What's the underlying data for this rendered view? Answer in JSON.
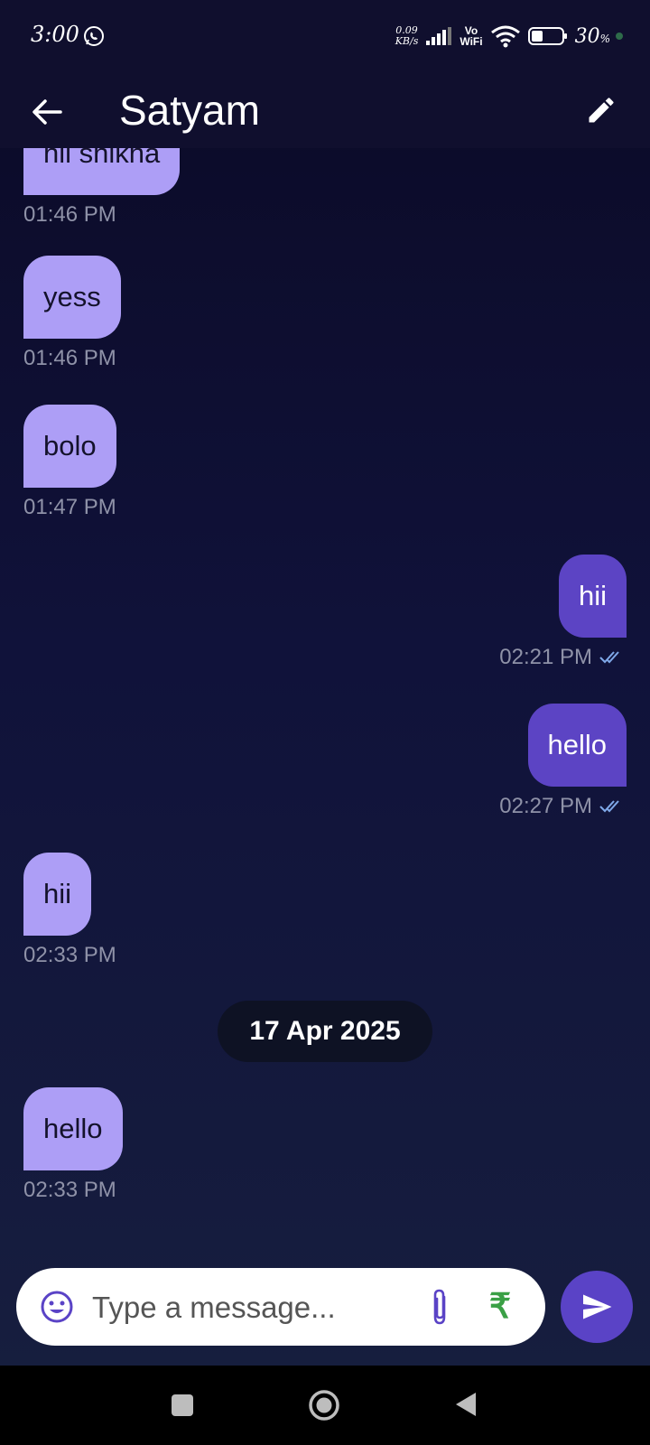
{
  "status_bar": {
    "time": "3:00",
    "net_speed_value": "0.09",
    "net_speed_unit": "KB/s",
    "vo": "Vo",
    "wifi": "WiFi",
    "battery": "30",
    "battery_unit": "%"
  },
  "header": {
    "title": "Satyam"
  },
  "messages": [
    {
      "text": "hii shikha",
      "time": "01:46 PM",
      "direction": "incoming"
    },
    {
      "text": "yess",
      "time": "01:46 PM",
      "direction": "incoming"
    },
    {
      "text": "bolo",
      "time": "01:47 PM",
      "direction": "incoming"
    },
    {
      "text": "hii",
      "time": "02:21 PM",
      "direction": "outgoing",
      "read": true
    },
    {
      "text": "hello",
      "time": "02:27 PM",
      "direction": "outgoing",
      "read": true
    },
    {
      "text": "hii",
      "time": "02:33 PM",
      "direction": "incoming"
    },
    {
      "text": "hello",
      "time": "02:33 PM",
      "direction": "incoming"
    }
  ],
  "date_separator": "17 Apr 2025",
  "composer": {
    "placeholder": "Type a message...",
    "rupee": "₹"
  },
  "icons": {
    "back": "arrow-left-icon",
    "edit": "pencil-icon",
    "emoji": "emoji-icon",
    "attach": "paperclip-icon",
    "send": "send-icon"
  },
  "colors": {
    "incoming_bubble": "#ad9ef6",
    "outgoing_bubble": "#5c44c4",
    "send_button": "#5a43c6",
    "rupee": "#3aa045"
  }
}
